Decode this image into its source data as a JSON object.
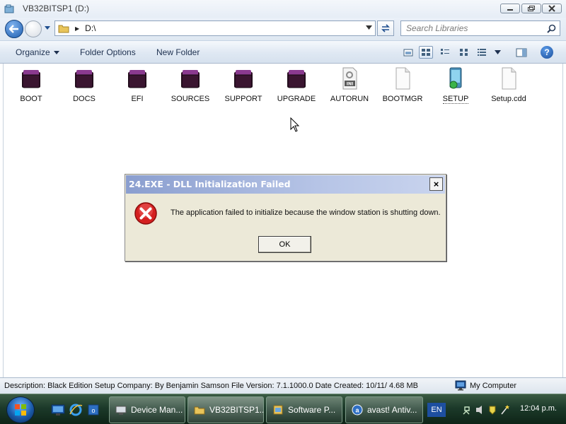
{
  "window": {
    "title": "VB32BITSP1 (D:)",
    "controls": {
      "minimize": "minimize",
      "maximize": "maximize",
      "close": "close"
    }
  },
  "address_bar": {
    "path": "D:\\",
    "search_placeholder": "Search Libraries"
  },
  "command_bar": {
    "organize": "Organize",
    "folder_options": "Folder Options",
    "new_folder": "New Folder",
    "help": "?"
  },
  "files": [
    {
      "name": "BOOT",
      "type": "folder"
    },
    {
      "name": "DOCS",
      "type": "folder"
    },
    {
      "name": "EFI",
      "type": "folder"
    },
    {
      "name": "SOURCES",
      "type": "folder"
    },
    {
      "name": "SUPPORT",
      "type": "folder"
    },
    {
      "name": "UPGRADE",
      "type": "folder"
    },
    {
      "name": "AUTORUN",
      "type": "ini-file"
    },
    {
      "name": "BOOTMGR",
      "type": "file"
    },
    {
      "name": "SETUP",
      "type": "setup-exe"
    },
    {
      "name": "Setup.cdd",
      "type": "file"
    }
  ],
  "ini_badge": "INI",
  "status_bar": {
    "description": "Description: Black Edition Setup Company: By Benjamin Samson File Version: 7.1.1000.0 Date Created: 10/11/  4.68 MB",
    "location": "My Computer"
  },
  "dialog": {
    "title": "24.EXE - DLL Initialization Failed",
    "close_label": "×",
    "message": "The application failed to initialize because the window station is shutting down.",
    "ok_label": "OK",
    "icon": "error-icon"
  },
  "taskbar": {
    "tasks": [
      {
        "label": "Device Man...",
        "icon": "device-manager-icon"
      },
      {
        "label": "VB32BITSP1...",
        "icon": "explorer-icon"
      },
      {
        "label": "Software P...",
        "icon": "software-icon"
      },
      {
        "label": "avast! Antiv...",
        "icon": "avast-icon"
      }
    ],
    "language": "EN",
    "clock": "12:04 p.m."
  },
  "colors": {
    "dialog_title_gradient_start": "#8a9ecf",
    "dialog_body": "#ece9d8",
    "taskbar": "#1c3a2a",
    "error_red": "#d42020"
  }
}
